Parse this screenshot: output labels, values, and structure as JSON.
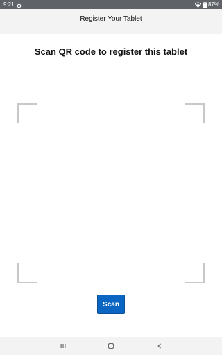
{
  "status_bar": {
    "time": "9:21",
    "battery": "87%",
    "icons": [
      "settings-gear-icon",
      "wifi-icon",
      "battery-icon"
    ]
  },
  "app_bar": {
    "title": "Register Your Tablet"
  },
  "main": {
    "headline": "Scan QR code to register this tablet",
    "scan_button_label": "Scan"
  },
  "nav_bar": {
    "icons": [
      "recents-icon",
      "home-icon",
      "back-icon"
    ]
  },
  "colors": {
    "status_bar": "#5f6368",
    "app_bar": "#f3f3f3",
    "accent": "#0a66c2",
    "viewfinder_corner": "#c8c8c8"
  }
}
